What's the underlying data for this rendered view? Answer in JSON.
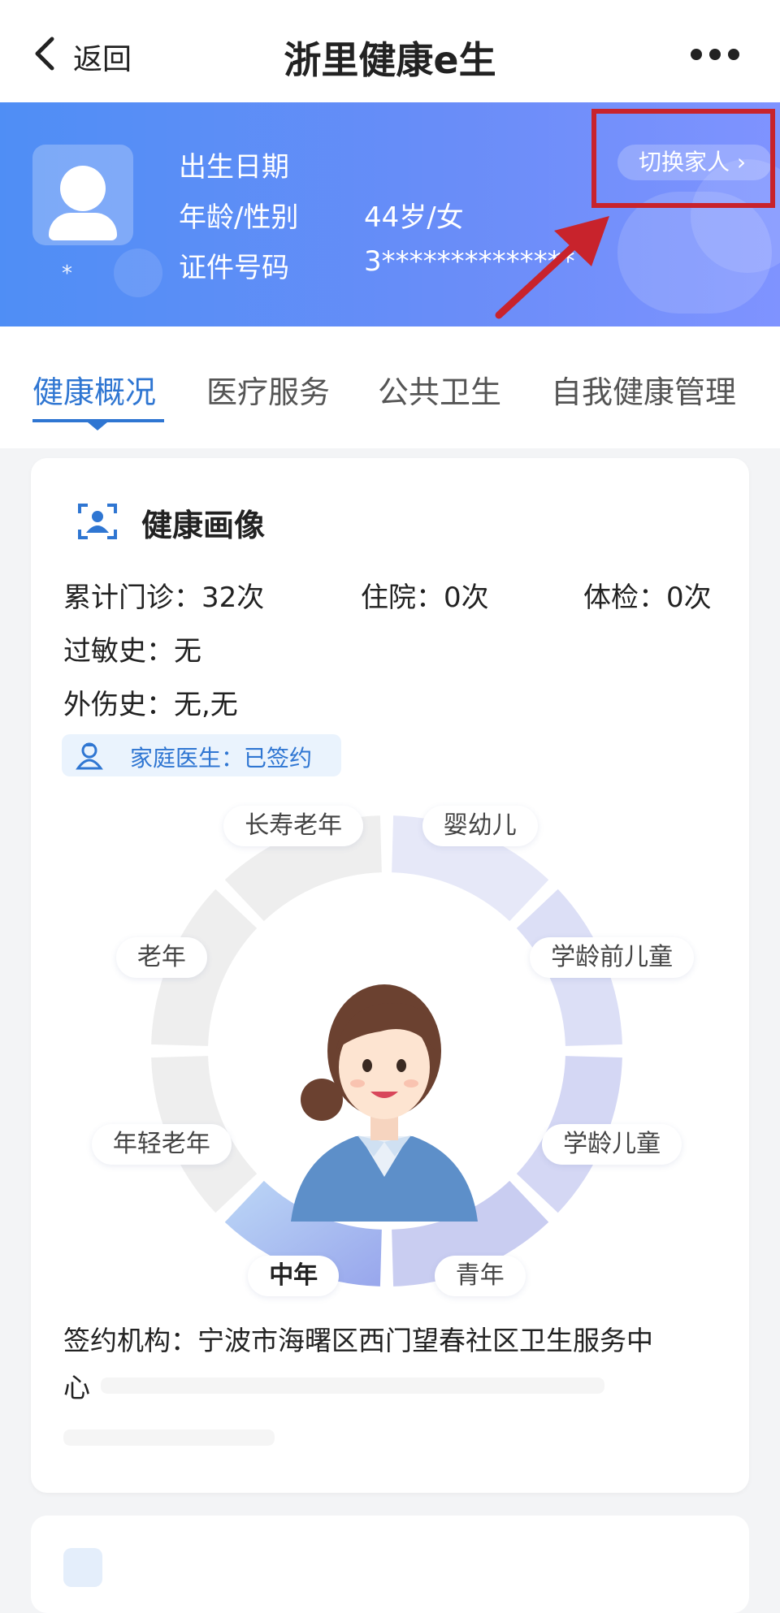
{
  "nav": {
    "back_label": "返回",
    "title": "浙里健康e生"
  },
  "profile": {
    "avatar_name": "*",
    "rows": [
      {
        "label": "出生日期",
        "value": ""
      },
      {
        "label": "年龄/性别",
        "value": "44岁/女"
      },
      {
        "label": "证件号码",
        "value": "3**************"
      }
    ],
    "switch_family_label": "切换家人 ›"
  },
  "tabs": [
    {
      "label": "健康概况",
      "active": true
    },
    {
      "label": "医疗服务",
      "active": false
    },
    {
      "label": "公共卫生",
      "active": false
    },
    {
      "label": "自我健康管理",
      "active": false
    }
  ],
  "health_profile": {
    "title": "健康画像",
    "stats": {
      "outpatient": "累计门诊：32次",
      "inpatient": "住院：0次",
      "checkup": "体检：0次",
      "allergy": "过敏史：无",
      "injury": "外伤史：无,无"
    },
    "family_doctor": "家庭医生：已签约",
    "life_stages": [
      "婴幼儿",
      "学龄前儿童",
      "学龄儿童",
      "青年",
      "中年",
      "年轻老年",
      "老年",
      "长寿老年"
    ],
    "active_stage": "中年",
    "org_line1": "签约机构：宁波市海曙区西门望春社区卫生服务中",
    "org_line2": "心"
  },
  "colors": {
    "accent": "#2f76d2",
    "banner_start": "#4f8ef5",
    "banner_end": "#7f93ff",
    "highlight": "#c8232c"
  }
}
